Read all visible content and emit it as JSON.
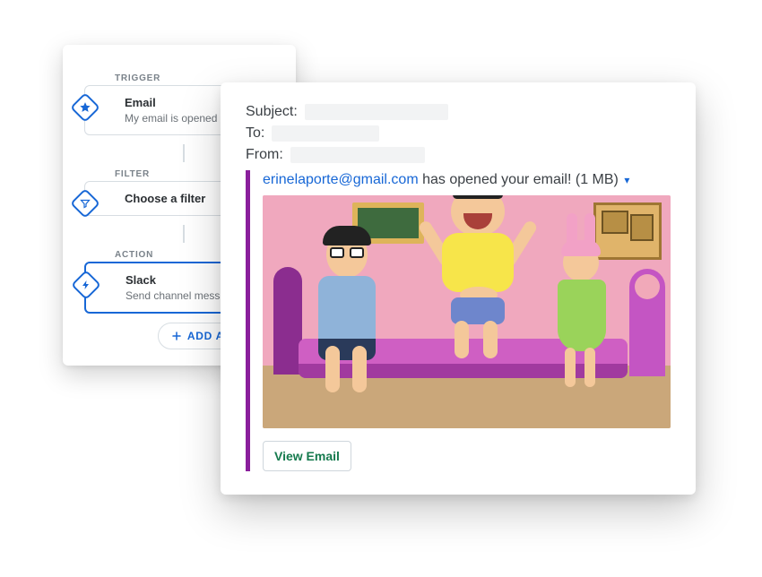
{
  "workflow": {
    "trigger": {
      "section_label": "TRIGGER",
      "title": "Email",
      "subtitle": "My email is opened",
      "icon": "star-icon"
    },
    "filter": {
      "section_label": "FILTER",
      "title": "Choose a filter",
      "icon": "funnel-icon"
    },
    "action": {
      "section_label": "ACTION",
      "title": "Slack",
      "subtitle": "Send channel message",
      "icon": "bolt-icon",
      "selected": true
    },
    "add_action_label": "ADD ACTION"
  },
  "notification": {
    "headers": {
      "subject_label": "Subject:",
      "to_label": "To:",
      "from_label": "From:"
    },
    "attachment": {
      "accent_color": "#8a1f9c",
      "email": "erinelaporte@gmail.com",
      "title_rest": " has opened your email! (1 MB)",
      "view_email_label": "View Email"
    }
  }
}
